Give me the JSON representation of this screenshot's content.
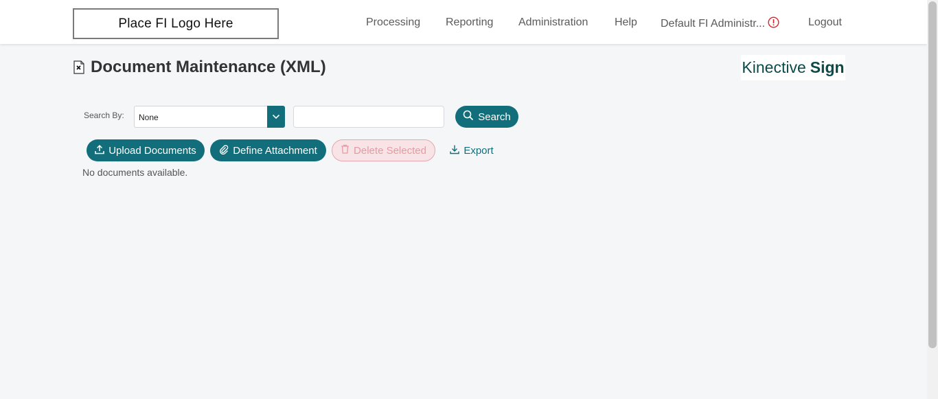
{
  "header": {
    "logo_text": "Place FI Logo Here",
    "nav": [
      {
        "label": "Processing"
      },
      {
        "label": "Reporting"
      },
      {
        "label": "Administration"
      },
      {
        "label": "Help"
      },
      {
        "label": "Default FI Administr..."
      },
      {
        "label": "Logout"
      }
    ],
    "alert_icon": "exclamation-circle-icon",
    "alert_color": "#e0202a"
  },
  "page": {
    "title": "Document Maintenance (XML)",
    "title_icon": "document-icon"
  },
  "brand": {
    "word1": "Kinective",
    "word2": "Sign"
  },
  "search": {
    "label": "Search By:",
    "selected": "None",
    "input_value": "",
    "button_label": "Search"
  },
  "actions": {
    "upload_label": "Upload Documents",
    "define_label": "Define Attachment",
    "delete_label": "Delete Selected",
    "export_label": "Export"
  },
  "empty_message": "No documents available.",
  "colors": {
    "accent": "#116e7a",
    "danger_light": "#f8e3e6",
    "background": "#f4f6f8"
  }
}
